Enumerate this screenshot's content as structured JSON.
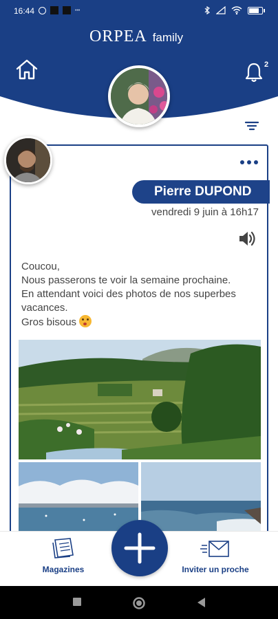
{
  "status_bar": {
    "time": "16:44"
  },
  "header": {
    "brand": "ORPEA",
    "brand_suffix": "family",
    "notifications_count": "2",
    "colors": {
      "primary": "#1a3f85",
      "accent_dark": "#1e4389"
    }
  },
  "icons": {
    "home": "home-icon",
    "bell": "bell-icon",
    "filter": "filter-icon",
    "more": "more-icon",
    "speaker": "speaker-icon",
    "magazine": "magazine-icon",
    "invite": "envelope-icon",
    "add": "plus-icon"
  },
  "post": {
    "author": "Pierre DUPOND",
    "date": "vendredi 9 juin à 16h17",
    "lines": [
      "Coucou,",
      "Nous passerons te voir la semaine prochaine.",
      "En attendant voici des photos de nos superbes vacances.",
      "Gros bisous"
    ]
  },
  "bottom_nav": {
    "magazines": "Magazines",
    "invite": "Inviter un proche"
  }
}
